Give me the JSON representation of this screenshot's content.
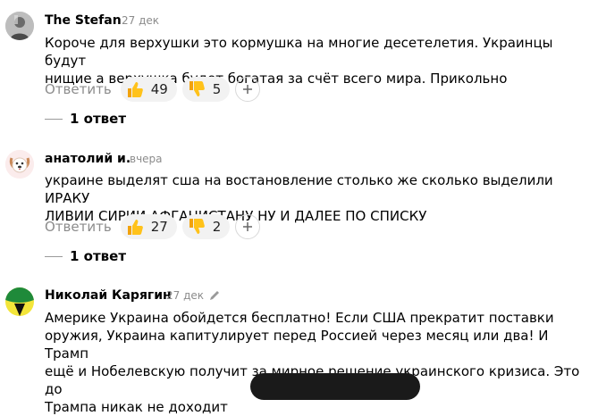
{
  "comments": [
    {
      "author": "The Stefan",
      "date": "27 дек",
      "text_lines": [
        "Короче для верхушки это кормушка на многие десетелетия. Украинцы будут",
        "нищие а верхушка будет богатая за счёт всего мира. Прикольно"
      ],
      "reply_label": "Ответить",
      "likes": "49",
      "dislikes": "5",
      "replies_label": "1 ответ",
      "avatar": "person-photo-icon"
    },
    {
      "author": "анатолий и.",
      "date": "вчера",
      "text_lines": [
        "украине выделят сша на востановление столько же сколько выделили ИРАКУ",
        "ЛИВИИ СИРИИ АФГАНИСТАНУ НУ И ДАЛЕЕ ПО СПИСКУ"
      ],
      "reply_label": "Ответить",
      "likes": "27",
      "dislikes": "2",
      "replies_label": "1 ответ",
      "avatar": "dog-face-icon"
    },
    {
      "author": "Николай Карягин",
      "date": "27 дек",
      "text_lines": [
        "Америке Украина обойдется бесплатно! Если США прекратит поставки",
        "оружия, Украина капитулирует перед Россией через месяц или два! И Трамп",
        "ещё и Нобелевскую получит за мирное решение украинского кризиса. Это до",
        "Трампа никак не доходит"
      ],
      "avatar": "yellow-green-avatar-icon",
      "edited_icon": "pencil-icon"
    }
  ]
}
